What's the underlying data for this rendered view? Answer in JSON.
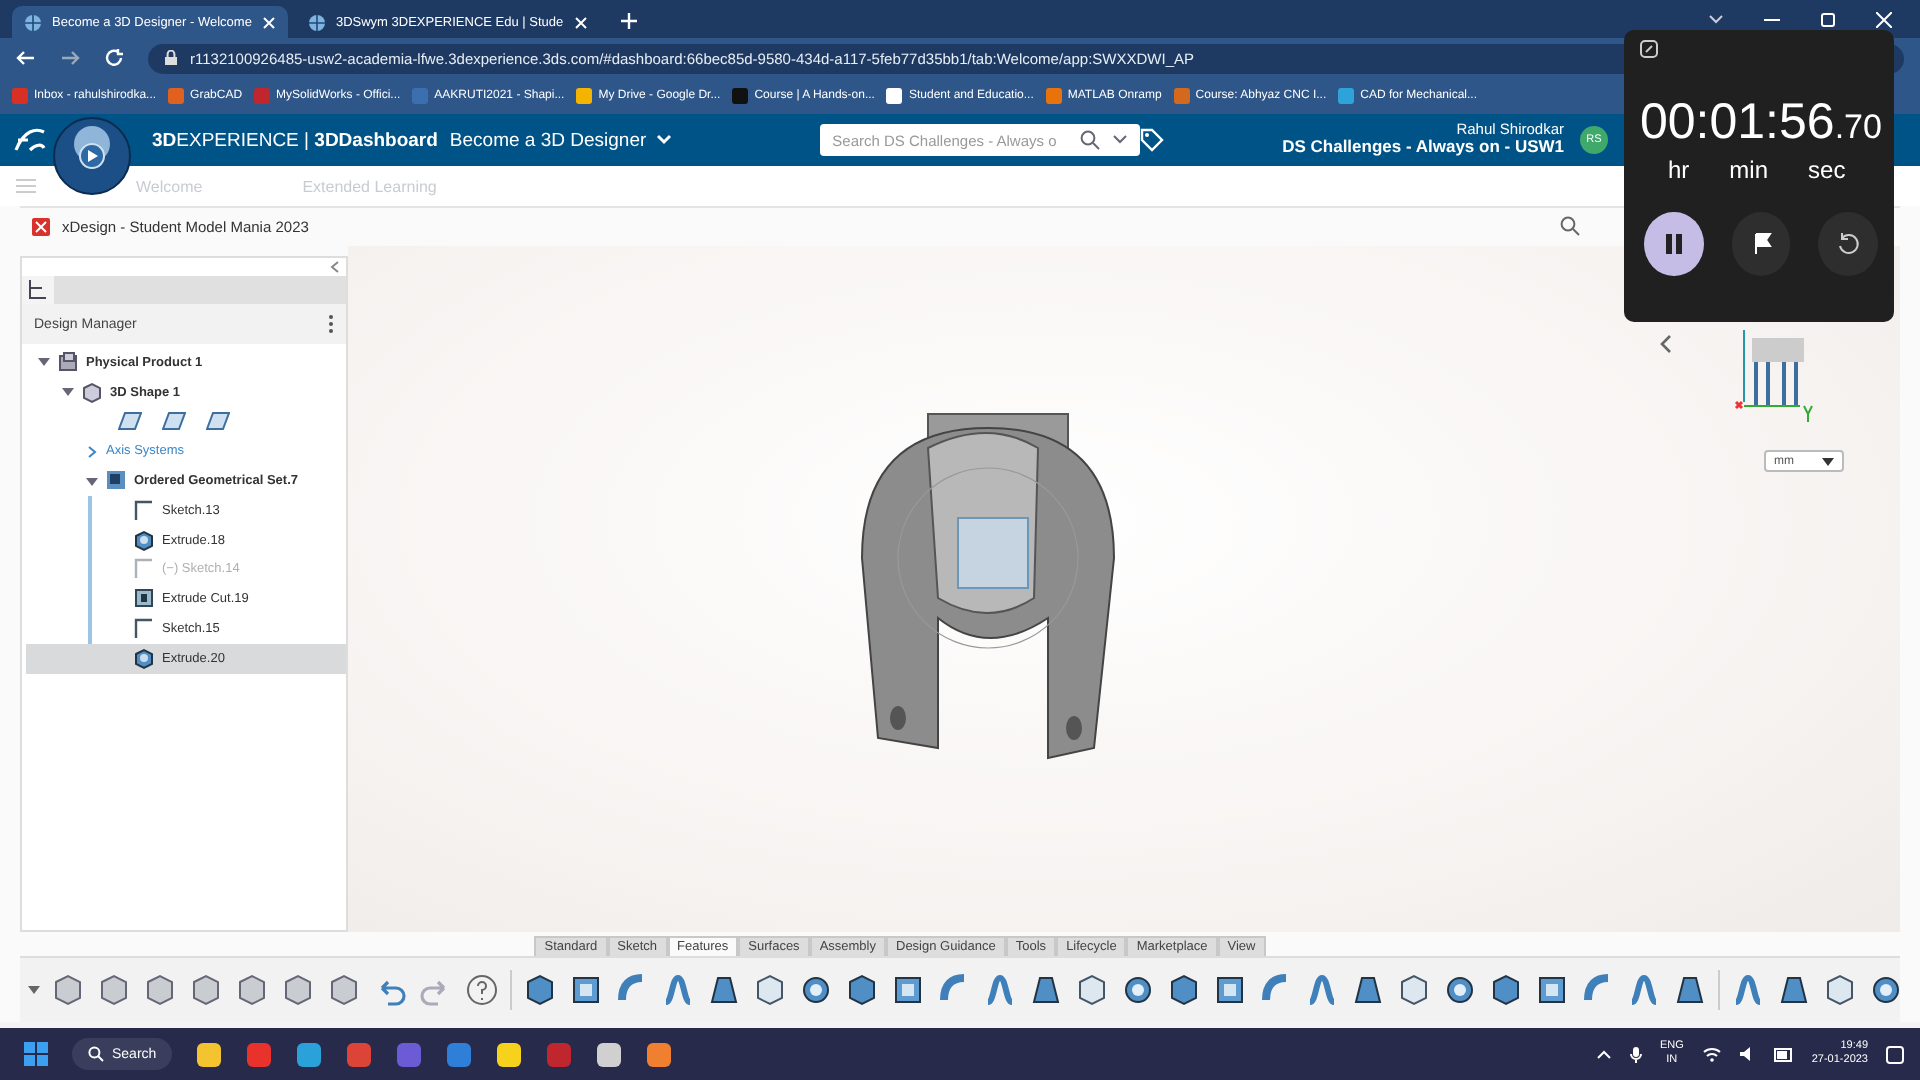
{
  "browser": {
    "tabs": [
      {
        "label": "Become a 3D Designer - Welcome",
        "selected": true
      },
      {
        "label": "3DSwym 3DEXPERIENCE Edu | Stude",
        "selected": false
      }
    ],
    "address": "r1132100926485-usw2-academia-lfwe.3dexperience.3ds.com/#dashboard:66bec85d-9580-434d-a117-5feb77d35bb1/tab:Welcome/app:SWXXDWI_AP",
    "bookmarks": [
      {
        "label": "Inbox - rahulshirodka...",
        "color": "#d93025"
      },
      {
        "label": "GrabCAD",
        "color": "#e06020"
      },
      {
        "label": "MySolidWorks - Offici...",
        "color": "#c0262d"
      },
      {
        "label": "AAKRUTI2021 - Shapi...",
        "color": "#3b6fb0"
      },
      {
        "label": "My Drive - Google Dr...",
        "color": "#f4b400"
      },
      {
        "label": "Course | A Hands-on...",
        "color": "#111111"
      },
      {
        "label": "Student and Educatio...",
        "color": "#ffffff"
      },
      {
        "label": "MATLAB Onramp",
        "color": "#e8720c"
      },
      {
        "label": "Course: Abhyaz CNC I...",
        "color": "#d2691e"
      },
      {
        "label": "CAD for Mechanical...",
        "color": "#2ea3d9"
      }
    ]
  },
  "topbar": {
    "brand": "**3D**EXPERIENCE | **3DDashboard**",
    "dashboard": "Become a 3D Designer",
    "search_placeholder": "Search DS Challenges - Always o",
    "user": "Rahul Shirodkar",
    "platform": "DS Challenges - Always on - USW1",
    "avatar": "RS"
  },
  "subtabs": [
    {
      "label": "Welcome"
    },
    {
      "label": "Extended Learning"
    }
  ],
  "app_title": "xDesign - Student Model Mania 2023",
  "design_manager": {
    "title": "Design Manager",
    "tree": [
      {
        "label": "Physical Product 1",
        "kind": "product",
        "expanded": true,
        "selected": false,
        "disabled": false,
        "children": [
          {
            "label": "3D Shape 1",
            "kind": "shape",
            "expanded": true,
            "selected": false,
            "disabled": false,
            "children": [
              {
                "kind": "planes"
              },
              {
                "label": "Axis Systems",
                "kind": "folder",
                "expanded": false,
                "selected": false,
                "disabled": false
              },
              {
                "label": "Ordered Geometrical Set.7",
                "kind": "set",
                "expanded": true,
                "selected": false,
                "disabled": false,
                "children": [
                  {
                    "label": "Sketch.13",
                    "kind": "sketch",
                    "selected": false,
                    "disabled": false
                  },
                  {
                    "label": "Extrude.18",
                    "kind": "extrude",
                    "selected": false,
                    "disabled": false
                  },
                  {
                    "label": "Sketch.14",
                    "kind": "sketch",
                    "selected": false,
                    "disabled": true,
                    "prefix": "(−)"
                  },
                  {
                    "label": "Extrude Cut.19",
                    "kind": "cut",
                    "selected": false,
                    "disabled": false
                  },
                  {
                    "label": "Sketch.15",
                    "kind": "sketch",
                    "selected": false,
                    "disabled": false
                  },
                  {
                    "label": "Extrude.20",
                    "kind": "extrude",
                    "selected": true,
                    "disabled": false
                  }
                ]
              }
            ]
          }
        ]
      }
    ]
  },
  "viewport": {
    "unit": "mm"
  },
  "ribbon_tabs": [
    {
      "label": "Standard",
      "selected": false
    },
    {
      "label": "Sketch",
      "selected": false
    },
    {
      "label": "Features",
      "selected": true
    },
    {
      "label": "Surfaces",
      "selected": false
    },
    {
      "label": "Assembly",
      "selected": false
    },
    {
      "label": "Design Guidance",
      "selected": false
    },
    {
      "label": "Tools",
      "selected": false
    },
    {
      "label": "Lifecycle",
      "selected": false
    },
    {
      "label": "Marketplace",
      "selected": false
    },
    {
      "label": "View",
      "selected": false
    }
  ],
  "stopwatch": {
    "time": "00:01:56",
    "fraction": ".70",
    "units": [
      "hr",
      "min",
      "sec"
    ],
    "running": true
  },
  "taskbar": {
    "search": "Search",
    "language": "ENG",
    "region": "IN",
    "time": "19:49",
    "date": "27-01-2023"
  }
}
